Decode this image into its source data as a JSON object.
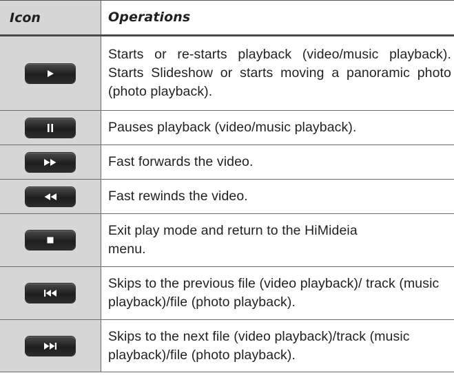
{
  "header": {
    "icon_col": "Icon",
    "operations_col": "Operations"
  },
  "rows": [
    {
      "icon": "play-icon",
      "text": "Starts or re-starts playback (video/music playback). Starts Slideshow or starts moving a panoramic photo (photo playback)."
    },
    {
      "icon": "pause-icon",
      "text": "Pauses playback (video/music playback)."
    },
    {
      "icon": "fast-forward-icon",
      "text": "Fast forwards the video."
    },
    {
      "icon": "fast-rewind-icon",
      "text": "Fast rewinds the video."
    },
    {
      "icon": "stop-icon",
      "text": "Exit play mode and return to the HiMideia menu."
    },
    {
      "icon": "skip-previous-icon",
      "text": "Skips to the previous file (video playback)/ track (music playback)/file (photo playback)."
    },
    {
      "icon": "skip-next-icon",
      "text": "Skips to the next file (video playback)/track (music playback)/file (photo playback)."
    }
  ],
  "colors": {
    "icon_column_bg": "#d6d6d6",
    "button_bg": "#2a2a2a",
    "glyph": "#ffffff",
    "rule": "#6b6b6b"
  }
}
